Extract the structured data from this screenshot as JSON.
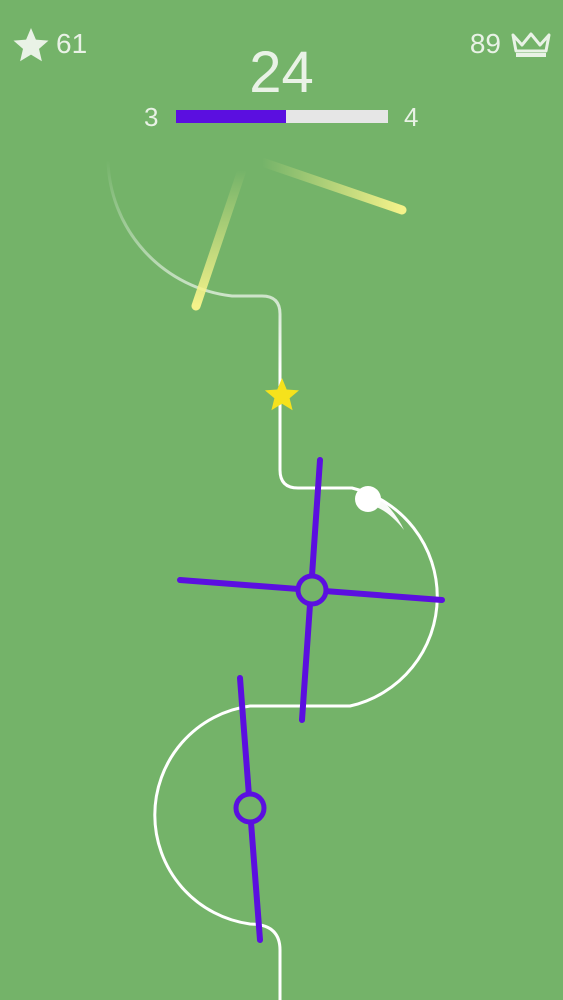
{
  "hud": {
    "stars_collected": "61",
    "star_icon": "star-icon",
    "best_score": "89",
    "crown_icon": "crown-icon",
    "score": "24"
  },
  "level": {
    "current": "3",
    "next": "4",
    "progress_fraction": 0.52
  },
  "colors": {
    "background": "#74b369",
    "spinner": "#5b0fe0",
    "track": "#ffffff",
    "pickup_star": "#f6e21c",
    "faded_spinner": "#f4f28a",
    "hud_text": "#e9f2e6"
  },
  "board": {
    "pickup": "star-pickup",
    "ball": "player-ball",
    "obstacles": [
      "spinner-cross",
      "spinner-bar",
      "faded-spinner"
    ]
  }
}
